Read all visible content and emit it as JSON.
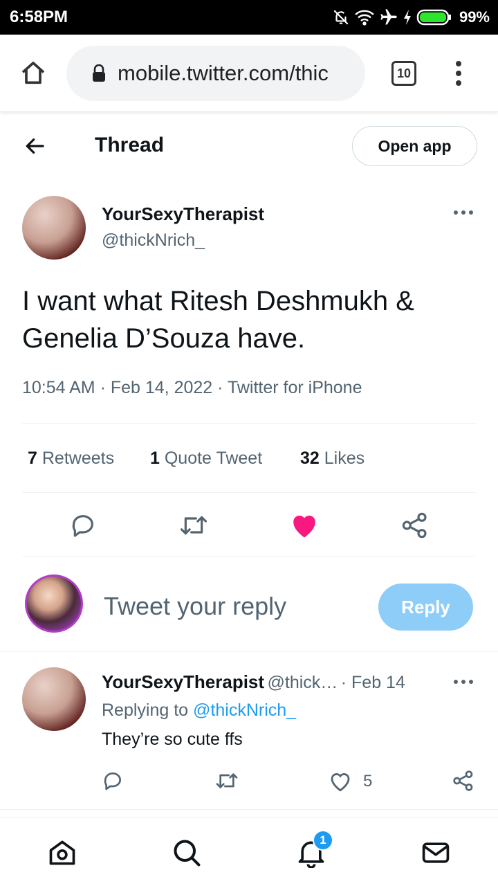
{
  "status_bar": {
    "time": "6:58PM",
    "battery_percent": "99%",
    "icons": [
      "mute-icon",
      "wifi-icon",
      "airplane-icon",
      "charging-icon",
      "battery-icon"
    ]
  },
  "browser": {
    "url": "mobile.twitter.com/thic",
    "tab_count": "10"
  },
  "header": {
    "title": "Thread",
    "open_app_label": "Open app"
  },
  "tweet": {
    "author_name": "YourSexyTherapist",
    "author_handle": "@thickNrich_",
    "text": "I want what Ritesh Deshmukh & Genelia D’Souza have.",
    "meta": "10:54 AM · Feb 14, 2022 · Twitter for iPhone",
    "stats": {
      "retweets_count": "7",
      "retweets_label": "Retweets",
      "quotes_count": "1",
      "quotes_label": "Quote Tweet",
      "likes_count": "32",
      "likes_label": "Likes"
    },
    "liked": true
  },
  "reply_composer": {
    "placeholder": "Tweet your reply",
    "button_label": "Reply"
  },
  "reply": {
    "author_name": "YourSexyTherapist",
    "author_handle": "@thick…",
    "date": "· Feb 14",
    "replying_to_prefix": "Replying to",
    "replying_to_handle": "@thickNrich_",
    "text": "They’re so cute ffs",
    "like_count": "5"
  },
  "bottom_nav": {
    "items": [
      "home-icon",
      "search-icon",
      "notifications-icon",
      "messages-icon"
    ],
    "notification_badge": "1"
  },
  "colors": {
    "accent": "#1d9bf0",
    "like": "#f91880",
    "reply_button": "#8ecdf8"
  }
}
